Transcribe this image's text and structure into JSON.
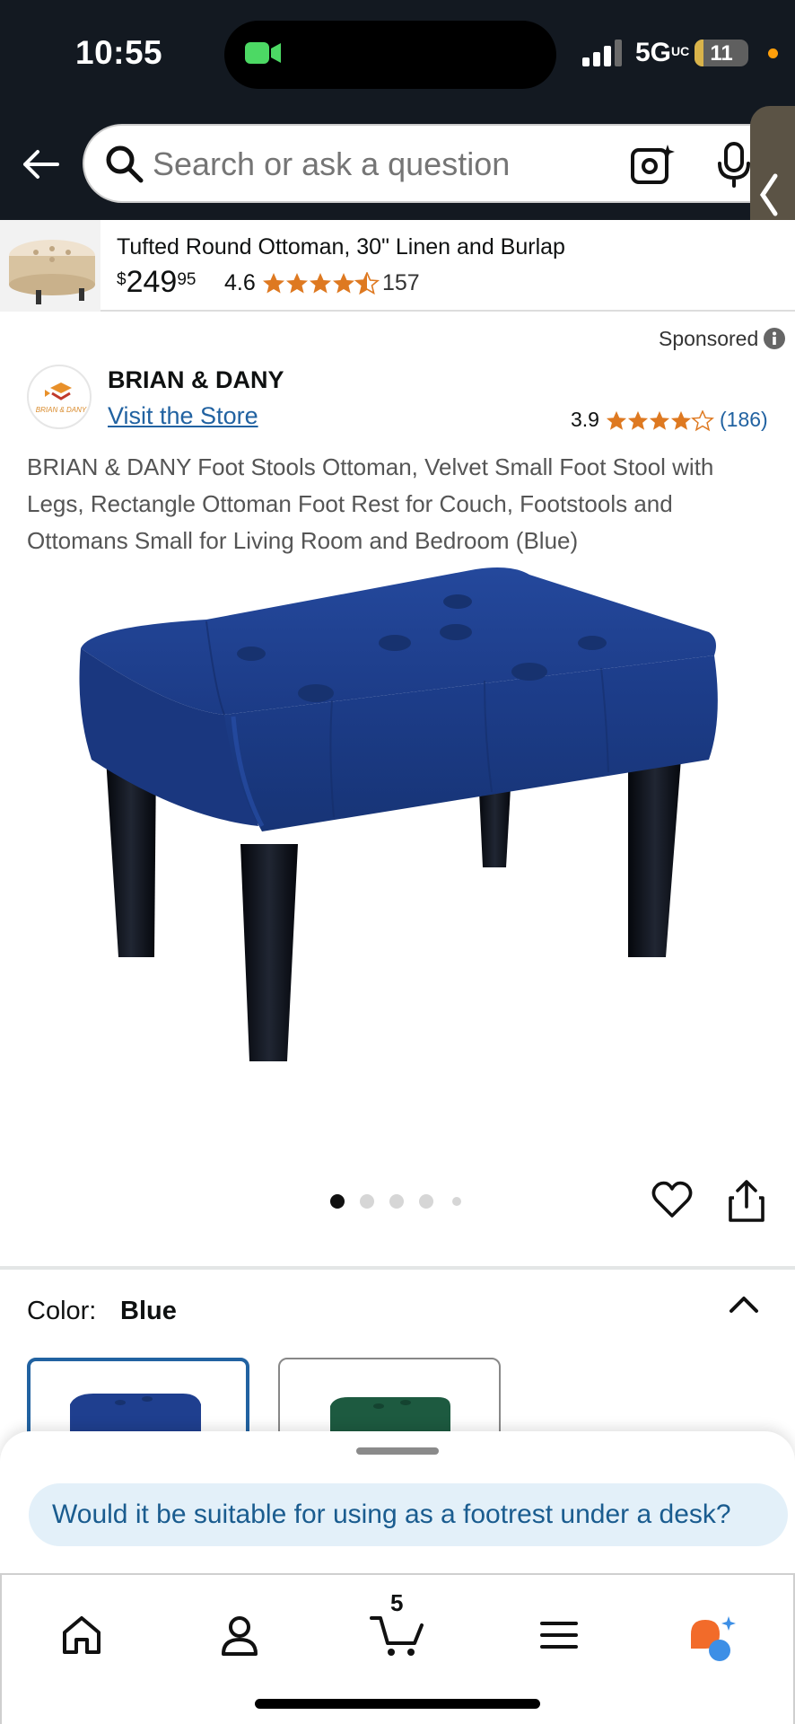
{
  "status_bar": {
    "time": "10:55",
    "network": "5G",
    "network_suffix": "UC",
    "battery": "11"
  },
  "search": {
    "placeholder": "Search or ask a question"
  },
  "sticky_product": {
    "title": "Tufted Round Ottoman, 30\" Linen and Burlap",
    "price_currency": "$",
    "price_whole": "249",
    "price_fraction": "95",
    "rating": "4.6",
    "review_count": "157"
  },
  "sponsored_label": "Sponsored",
  "product": {
    "brand": "BRIAN & DANY",
    "logo_text": "BRIAN & DANY",
    "store_link": "Visit the Store",
    "rating": "3.9",
    "review_count": "(186)",
    "title": "BRIAN & DANY Foot Stools Ottoman, Velvet Small Foot Stool with Legs, Rectangle Ottoman Foot Rest for Couch, Footstools and Ottomans Small for Living Room and Bedroom (Blue)",
    "image_count": 5,
    "current_image": 1
  },
  "color": {
    "label": "Color:",
    "value": "Blue"
  },
  "assistant": {
    "suggestion": "Would it be suitable for using as a footrest under a desk?"
  },
  "cart": {
    "count": "5"
  },
  "colors": {
    "accent_link": "#2162A1",
    "star": "#DE7921",
    "dark_header": "#131921",
    "velvet_blue": "#1f3f8f",
    "velvet_green": "#1d5a40"
  }
}
